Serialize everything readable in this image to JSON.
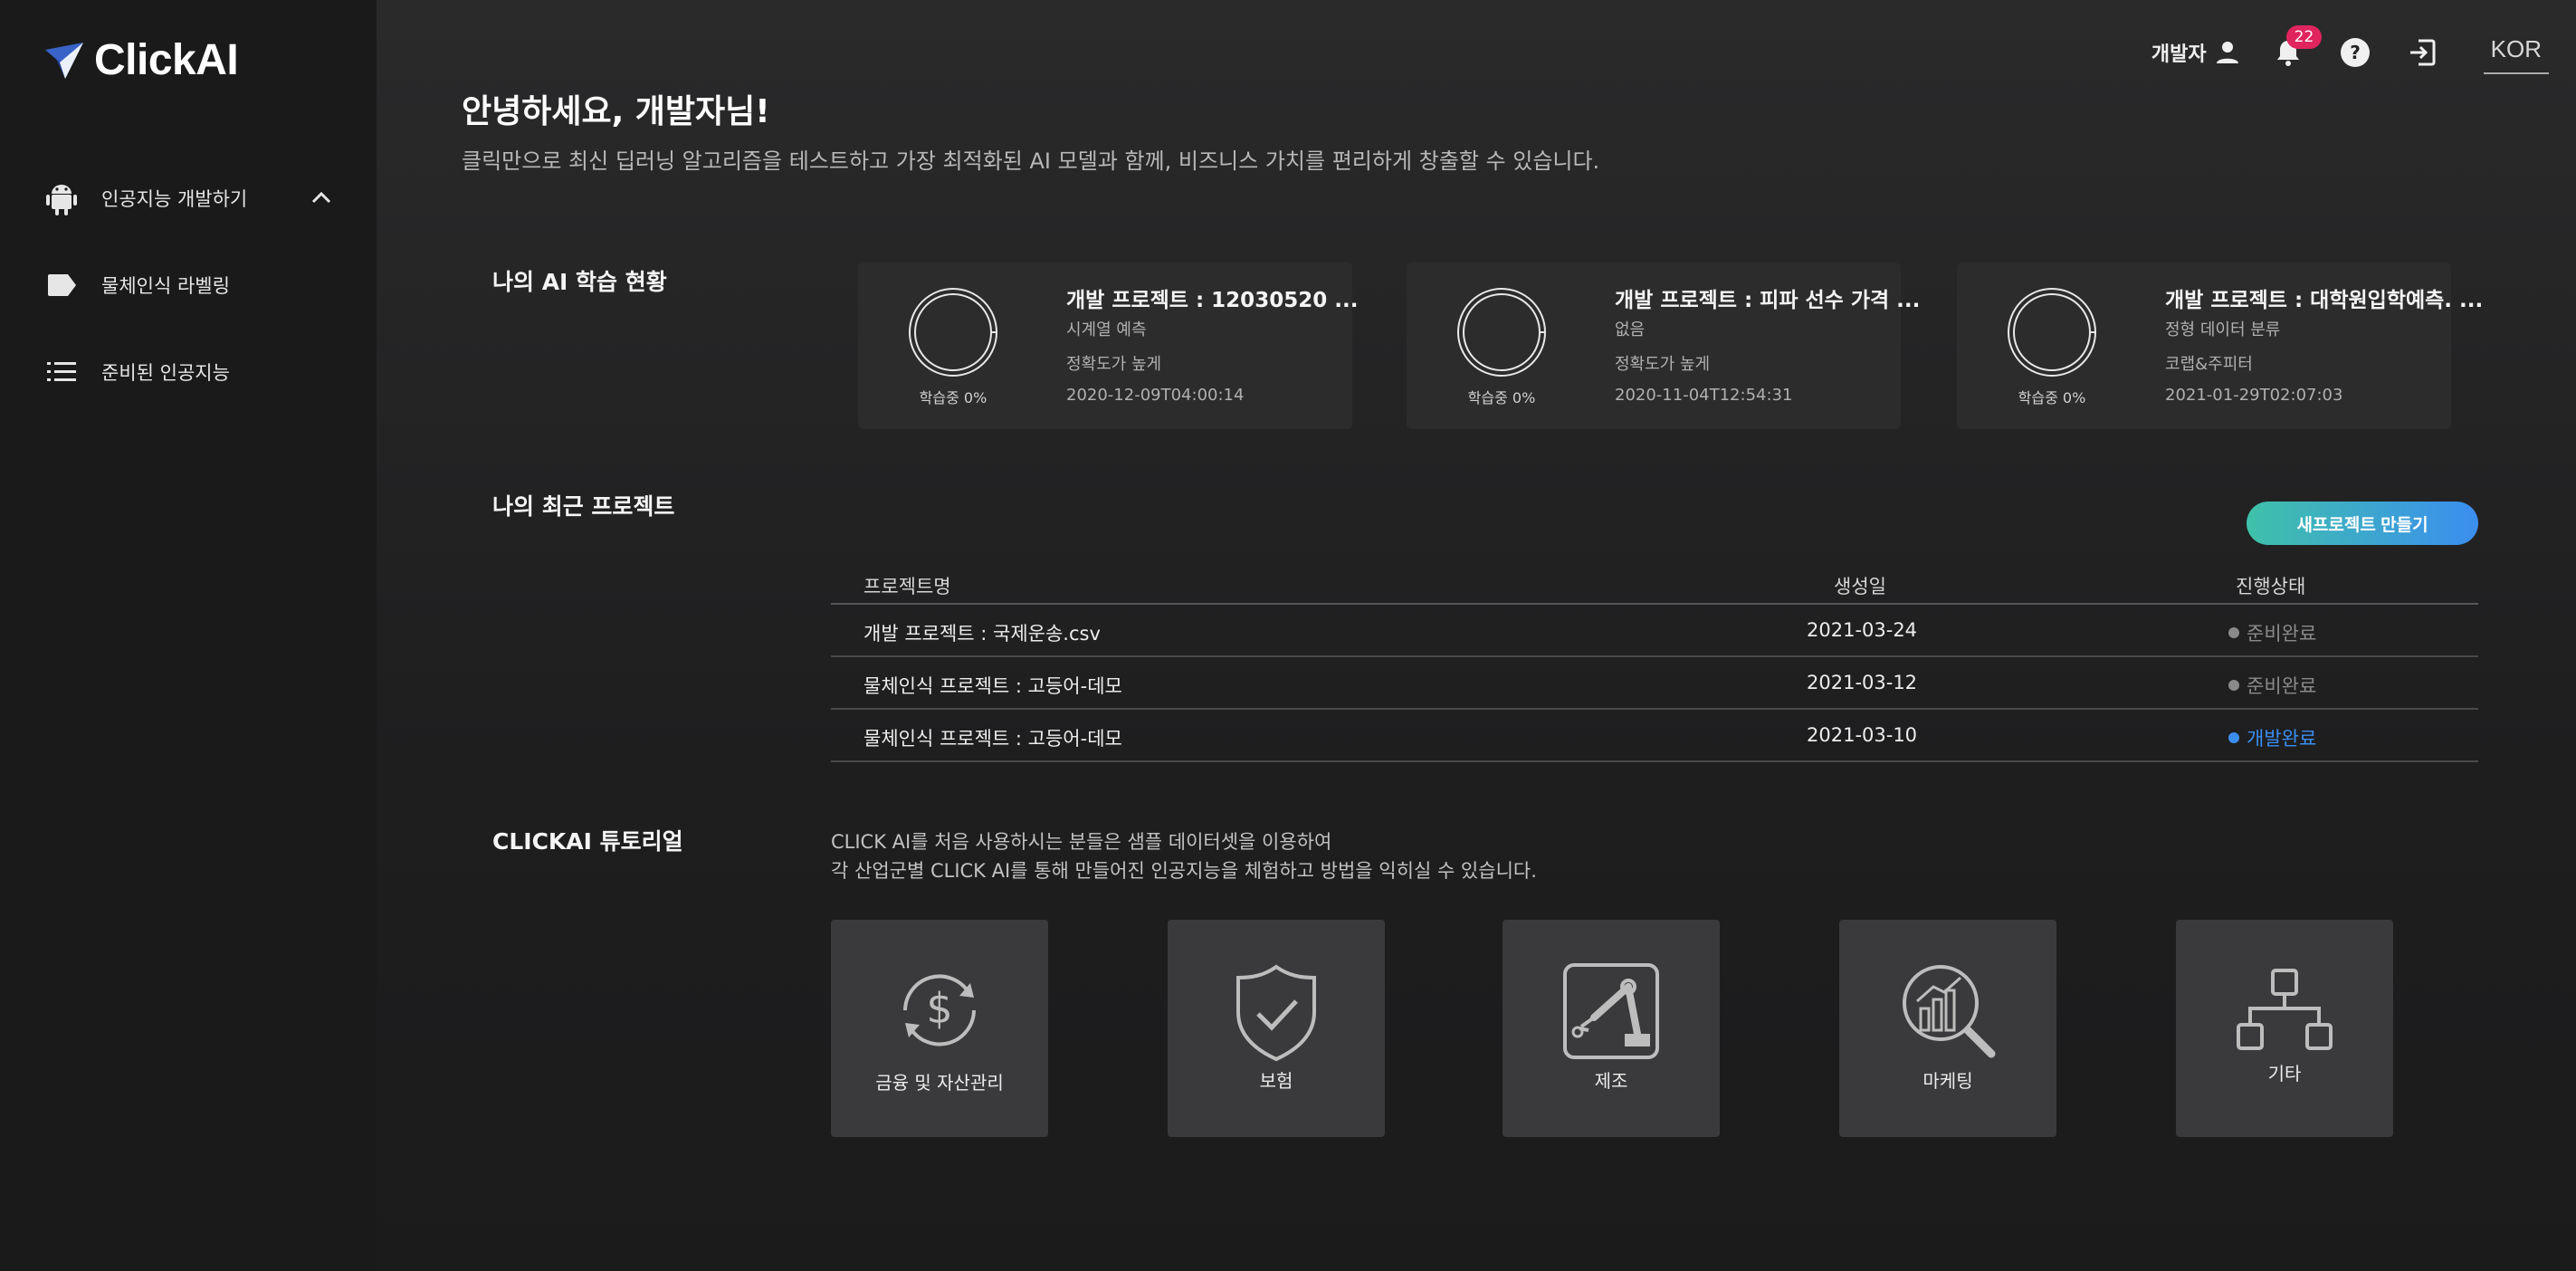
{
  "app": {
    "name": "ClickAI"
  },
  "sidebar": {
    "items": [
      {
        "label": "인공지능 개발하기",
        "icon": "android-icon"
      },
      {
        "label": "물체인식 라벨링",
        "icon": "label-tag-icon"
      },
      {
        "label": "준비된 인공지능",
        "icon": "list-icon"
      }
    ]
  },
  "topbar": {
    "user_label": "개발자",
    "notification_count": "22",
    "language": "KOR"
  },
  "greeting": {
    "title": "안녕하세요, 개발자님!",
    "subtitle": "클릭만으로 최신 딥러닝 알고리즘을 테스트하고 가장 최적화된 AI 모델과 함께, 비즈니스 가치를 편리하게 창출할 수 있습니다."
  },
  "ai_status": {
    "title": "나의 AI 학습 현황",
    "cards": [
      {
        "title": "개발 프로젝트 : 12030520 ...",
        "type": "시계열 예측",
        "priority": "정확도가 높게",
        "date": "2020-12-09T04:00:14",
        "progress_label": "학습중 0%",
        "progress": 0
      },
      {
        "title": "개발 프로젝트 : 피파 선수 가격 ...",
        "type": "없음",
        "priority": "정확도가 높게",
        "date": "2020-11-04T12:54:31",
        "progress_label": "학습중 0%",
        "progress": 0
      },
      {
        "title": "개발 프로젝트 : 대학원입학예측. ...",
        "type": "정형 데이터 분류",
        "priority": "코랩&주피터",
        "date": "2021-01-29T02:07:03",
        "progress_label": "학습중 0%",
        "progress": 0
      }
    ]
  },
  "recent": {
    "title": "나의 최근 프로젝트",
    "new_button": "새프로젝트 만들기",
    "columns": [
      "프로젝트명",
      "생성일",
      "진행상태"
    ],
    "rows": [
      {
        "name": "개발 프로젝트 : 국제운송.csv",
        "date": "2021-03-24",
        "status": "준비완료",
        "status_color": "#8a8a8a"
      },
      {
        "name": "물체인식 프로젝트 : 고등어-데모",
        "date": "2021-03-12",
        "status": "준비완료",
        "status_color": "#8a8a8a"
      },
      {
        "name": "물체인식 프로젝트 : 고등어-데모",
        "date": "2021-03-10",
        "status": "개발완료",
        "status_color": "#3b8ef0"
      }
    ]
  },
  "tutorial": {
    "title": "CLICKAI 튜토리얼",
    "desc_line1": "CLICK AI를 처음 사용하시는 분들은 샘플 데이터셋을 이용하여",
    "desc_line2": "각 산업군별 CLICK AI를 통해 만들어진 인공지능을 체험하고 방법을 익히실 수 있습니다.",
    "tiles": [
      {
        "label": "금융 및 자산관리",
        "icon": "dollar-cycle-icon"
      },
      {
        "label": "보험",
        "icon": "shield-check-icon"
      },
      {
        "label": "제조",
        "icon": "robot-arm-icon"
      },
      {
        "label": "마케팅",
        "icon": "chart-magnifier-icon"
      },
      {
        "label": "기타",
        "icon": "hierarchy-icon"
      }
    ]
  },
  "colors": {
    "accent_blue": "#3b8ef0",
    "accent_teal": "#3fc1a9",
    "badge_red": "#e0245e"
  }
}
